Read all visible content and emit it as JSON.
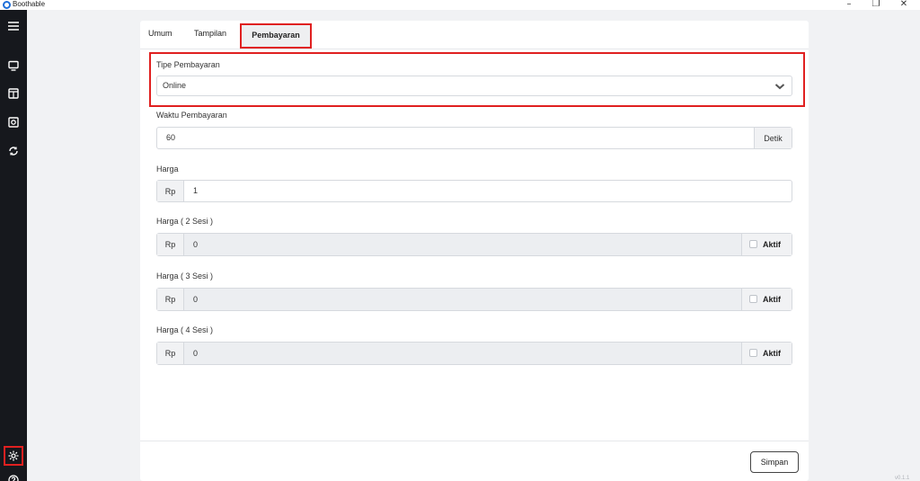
{
  "window": {
    "title": "Boothable",
    "controls": {
      "minimize": "–",
      "restore": "❐",
      "close": "✕"
    }
  },
  "sidebar": {
    "items": [
      {
        "icon": "menu-icon"
      },
      {
        "icon": "monitor-icon"
      },
      {
        "icon": "layout-icon"
      },
      {
        "icon": "camera-icon"
      },
      {
        "icon": "sync-icon"
      },
      {
        "icon": "gear-icon",
        "active": true
      },
      {
        "icon": "help-icon"
      }
    ]
  },
  "tabs": {
    "umum": "Umum",
    "tampilan": "Tampilan",
    "pembayaran": "Pembayaran",
    "active": "Pembayaran"
  },
  "form": {
    "tipe_pembayaran": {
      "label": "Tipe Pembayaran",
      "value": "Online"
    },
    "waktu_pembayaran": {
      "label": "Waktu Pembayaran",
      "value": "60",
      "suffix": "Detik"
    },
    "harga": {
      "label": "Harga",
      "prefix": "Rp",
      "value": "1"
    },
    "harga_2": {
      "label": "Harga ( 2 Sesi )",
      "prefix": "Rp",
      "value": "0",
      "toggle_label": "Aktif",
      "checked": false
    },
    "harga_3": {
      "label": "Harga ( 3 Sesi )",
      "prefix": "Rp",
      "value": "0",
      "toggle_label": "Aktif",
      "checked": false
    },
    "harga_4": {
      "label": "Harga ( 4 Sesi )",
      "prefix": "Rp",
      "value": "0",
      "toggle_label": "Aktif",
      "checked": false
    }
  },
  "footer": {
    "save_label": "Simpan",
    "version": "v0.1.1"
  },
  "colors": {
    "sidebar_bg": "#16181d",
    "highlight": "#e02020",
    "page_bg": "#f1f2f4"
  }
}
